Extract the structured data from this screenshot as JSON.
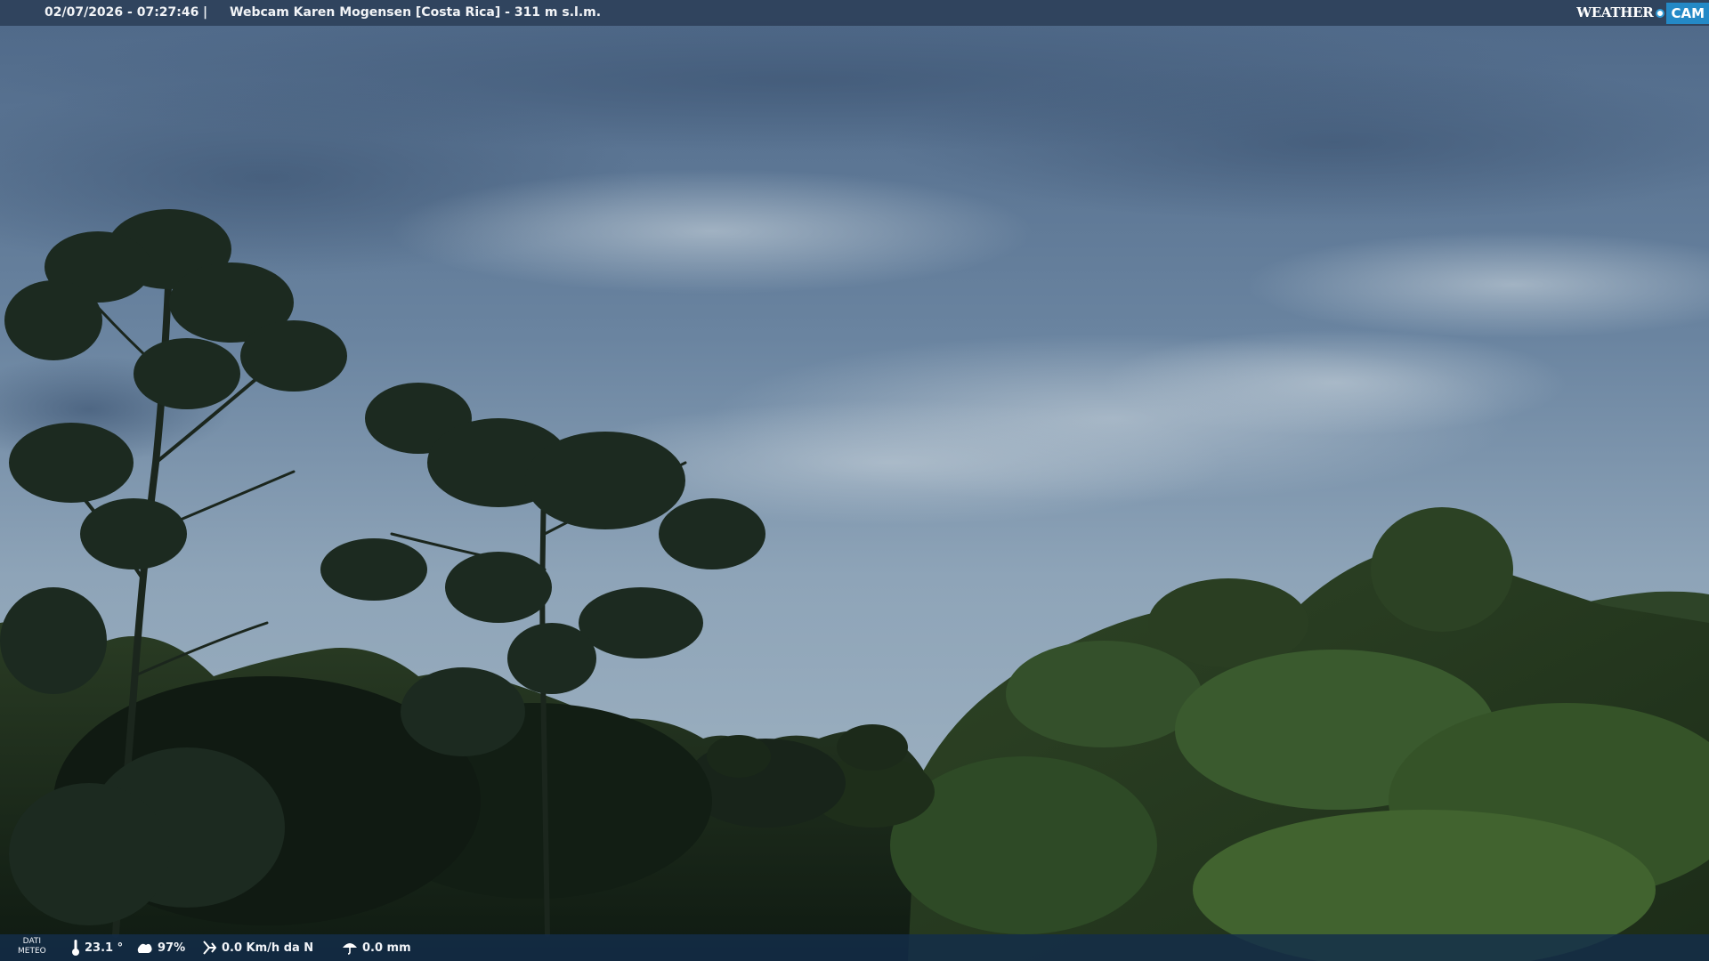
{
  "overlay": {
    "timestamp": "02/07/2026 - 07:27:46",
    "separator": "|",
    "title": "Webcam Karen Mogensen [Costa Rica]  - 311 m s.l.m."
  },
  "logo": {
    "weather": "WEATHER",
    "cam": "CAM"
  },
  "weather": {
    "label_line1": "DATI",
    "label_line2": "METEO",
    "temperature": "23.1 °",
    "humidity": "97%",
    "wind": "0.0 Km/h da N",
    "rain": "0.0 mm"
  },
  "colors": {
    "sky_top": "#55708f",
    "sky_bottom": "#9fb3c1",
    "foliage_dark": "#142018",
    "foliage_lit": "#3c5a2c",
    "bar_top": "#283a52",
    "bar_bottom": "#142d4b",
    "logo_accent": "#2489c6"
  }
}
